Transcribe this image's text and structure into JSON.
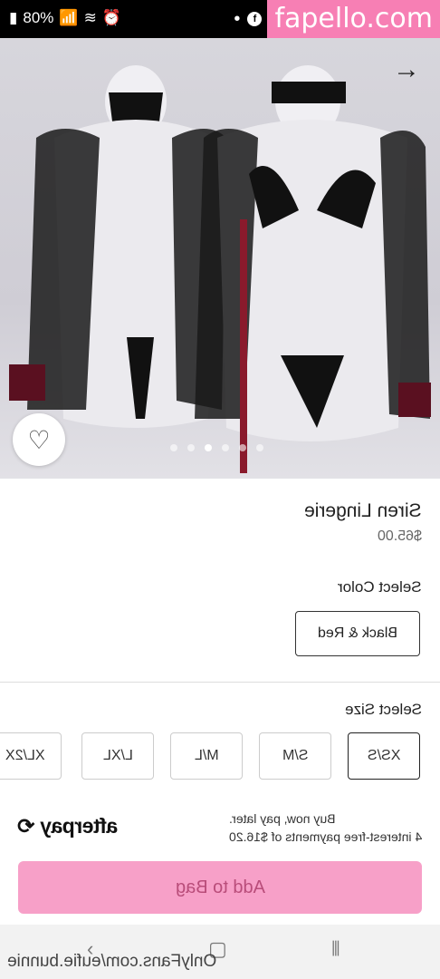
{
  "status_bar": {
    "battery": "80%",
    "watermark": "fapello.com",
    "fb_icon_letter": "f"
  },
  "product": {
    "name": "Siren Lingerie",
    "price": "$65.00",
    "image_dots": 6,
    "active_dot": 2
  },
  "color": {
    "label": "Select Color",
    "selected": "Black & Red"
  },
  "size": {
    "label": "Select Size",
    "options": [
      "XS/S",
      "S/M",
      "M/L",
      "L/XL",
      "XL/2X"
    ],
    "selected": "XS/S"
  },
  "afterpay": {
    "logo": "afterpay",
    "line1": "Buy now, pay later.",
    "line2": "4 interest-free payments of $16.20"
  },
  "cta": {
    "add_to_bag": "Add to Bag"
  },
  "footer": {
    "onlyfans": "OnlyFans.com/eufie.bunnie"
  },
  "colors": {
    "accent_pink": "#f7a0c8",
    "watermark_pink": "#f77fb4"
  }
}
